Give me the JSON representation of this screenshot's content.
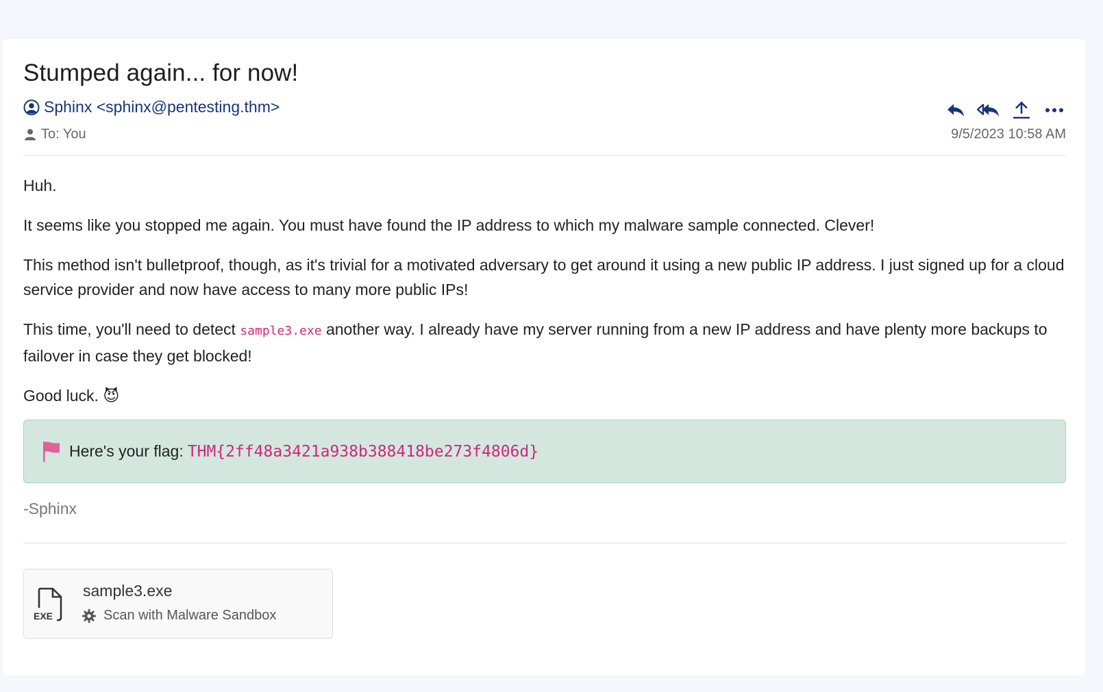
{
  "email": {
    "subject": "Stumped again... for now!",
    "from": "Sphinx <sphinx@pentesting.thm>",
    "to": "To: You",
    "date": "9/5/2023 10:58 AM",
    "actions": [
      "reply-icon",
      "reply-all-icon",
      "forward-icon",
      "more-icon"
    ],
    "body": {
      "p1": "Huh.",
      "p2": "It seems like you stopped me again. You must have found the IP address to which my malware sample connected. Clever!",
      "p3": "This method isn't bulletproof, though, as it's trivial for a motivated adversary to get around it using a new public IP address. I just signed up for a cloud service provider and now have access to many more public IPs!",
      "p4_before": "This time, you'll need to detect ",
      "p4_code": "sample3.exe",
      "p4_after": " another way. I already have my server running from a new IP address and have plenty more backups to failover in case they get blocked!",
      "p5": "Good luck.",
      "p5_emoji": "😈"
    },
    "flag": {
      "label": "Here's your flag:",
      "value": "THM{2ff48a3421a938b388418be273f4806d}",
      "icon": "flag-icon",
      "color": "#e0609a"
    },
    "signature": "-Sphinx",
    "attachment": {
      "filename": "sample3.exe",
      "icon_label": "EXE",
      "action": "Scan with Malware Sandbox"
    }
  },
  "colors": {
    "accent": "#15357a",
    "code": "#d0267a",
    "flag_bg": "#d3e7df",
    "flag_border": "#a9cfc0",
    "page_bg": "#f4f7fc"
  }
}
